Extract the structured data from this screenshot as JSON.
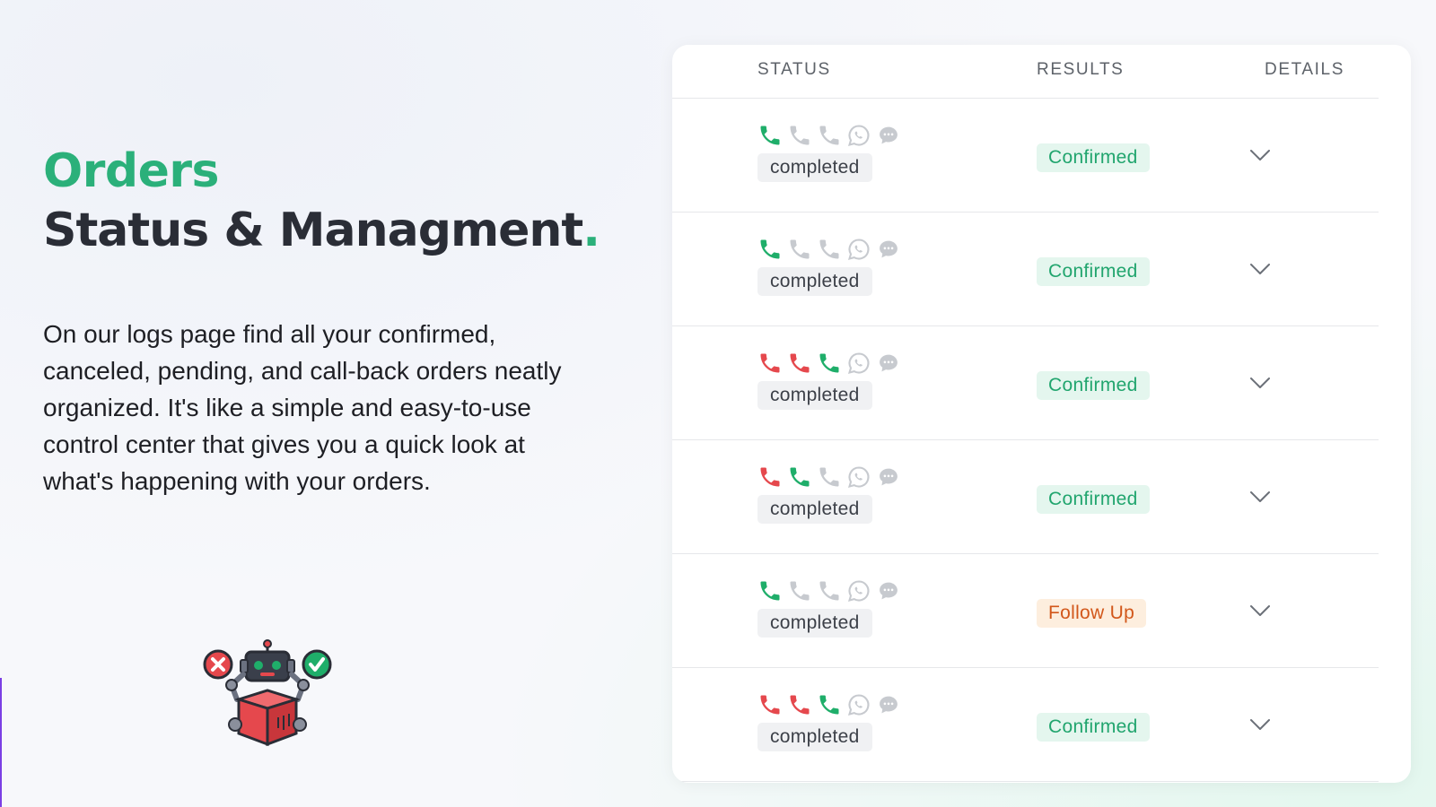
{
  "hero": {
    "title_line1": "Orders",
    "title_line2": "Status & Managment",
    "title_dot": ".",
    "description": "On our logs page find all your confirmed, canceled, pending, and call-back orders neatly organized. It's like a simple and easy-to-use control center that gives you a quick look at what's happening with your orders."
  },
  "colors": {
    "accent": "#2bb07a",
    "call_success": "#1fae6a",
    "call_failed": "#e5484d",
    "call_pending": "#c7cacf",
    "confirmed_text": "#21a56e",
    "followup_text": "#d2571a"
  },
  "table": {
    "headers": {
      "status": "STATUS",
      "results": "RESULTS",
      "details": "DETAILS"
    },
    "rows": [
      {
        "calls": [
          "success",
          "pending",
          "pending"
        ],
        "status": "completed",
        "result": "Confirmed",
        "result_type": "confirmed"
      },
      {
        "calls": [
          "success",
          "pending",
          "pending"
        ],
        "status": "completed",
        "result": "Confirmed",
        "result_type": "confirmed"
      },
      {
        "calls": [
          "failed",
          "failed",
          "success"
        ],
        "status": "completed",
        "result": "Confirmed",
        "result_type": "confirmed"
      },
      {
        "calls": [
          "failed",
          "success",
          "pending"
        ],
        "status": "completed",
        "result": "Confirmed",
        "result_type": "confirmed"
      },
      {
        "calls": [
          "success",
          "pending",
          "pending"
        ],
        "status": "completed",
        "result": "Follow Up",
        "result_type": "followup"
      },
      {
        "calls": [
          "failed",
          "failed",
          "success"
        ],
        "status": "completed",
        "result": "Confirmed",
        "result_type": "confirmed"
      }
    ],
    "icons": [
      "phone-icon",
      "whatsapp-icon",
      "message-icon",
      "chevron-down-icon"
    ]
  }
}
